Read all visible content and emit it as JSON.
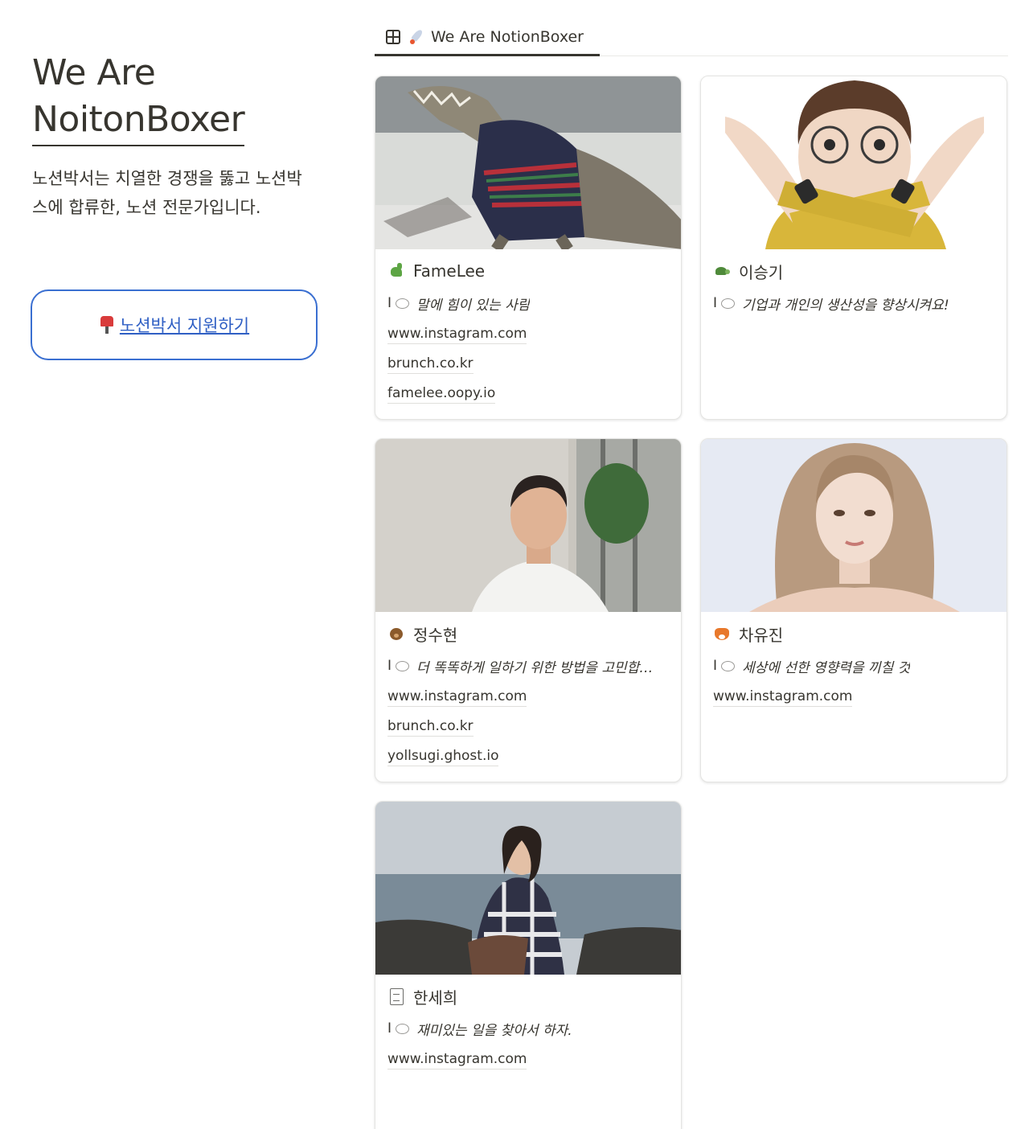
{
  "sidebar": {
    "title_line1": "We Are",
    "title_line2": "NoitonBoxer",
    "description": "노션박서는 치열한 경쟁을 뚫고 노션박스에 합류한, 노션 전문가입니다.",
    "apply_label": "노션박서 지원하기"
  },
  "view": {
    "tab_label": "We Are NotionBoxer"
  },
  "cards": [
    {
      "name": "FameLee",
      "icon": "dinosaur-icon",
      "quote": "말에 힘이 있는 사람",
      "links": [
        "www.instagram.com",
        "brunch.co.kr",
        "famelee.oopy.io"
      ]
    },
    {
      "name": "이승기",
      "icon": "turtle-icon",
      "quote": "기업과 개인의 생산성을 향상시켜요!",
      "links": []
    },
    {
      "name": "정수현",
      "icon": "bear-icon",
      "quote": "더 똑똑하게 일하기 위한 방법을 고민합…",
      "links": [
        "www.instagram.com",
        "brunch.co.kr",
        "yollsugi.ghost.io"
      ]
    },
    {
      "name": "차유진",
      "icon": "fox-icon",
      "quote": "세상에 선한 영향력을 끼칠 것",
      "links": [
        "www.instagram.com"
      ]
    },
    {
      "name": "한세희",
      "icon": "document-icon",
      "quote": "재미있는 일을 찾아서 하자.",
      "links": [
        "www.instagram.com"
      ]
    }
  ],
  "colors": {
    "text": "#37352f",
    "accent_blue": "#3a6fd1",
    "border": "#e4e4e2"
  }
}
